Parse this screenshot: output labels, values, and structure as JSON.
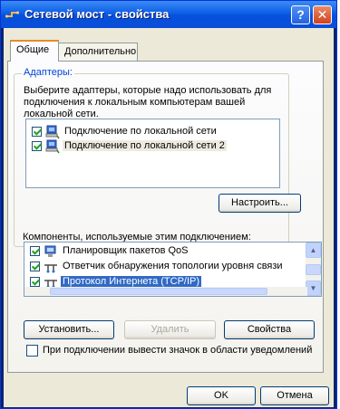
{
  "window": {
    "title": "Сетевой мост - свойства",
    "help_button": "?",
    "close_button": "✕"
  },
  "tabs": [
    {
      "label": "Общие",
      "active": true
    },
    {
      "label": "Дополнительно",
      "active": false
    }
  ],
  "adapters": {
    "legend": "Адаптеры:",
    "description": "Выберите адаптеры, которые надо использовать для подключения к локальным компьютерам вашей локальной сети.",
    "items": [
      {
        "label": "Подключение по локальной сети",
        "checked": true
      },
      {
        "label": "Подключение по локальной сети 2",
        "checked": true
      }
    ],
    "configure_button": "Настроить..."
  },
  "components": {
    "label": "Компоненты, используемые этим подключением:",
    "items": [
      {
        "label": "Планировщик пакетов QoS",
        "checked": true,
        "icon": "network-service-icon"
      },
      {
        "label": "Ответчик обнаружения топологии уровня связи",
        "checked": true,
        "icon": "protocol-icon"
      },
      {
        "label": "Протокол Интернета (TCP/IP)",
        "checked": true,
        "icon": "protocol-icon",
        "selected": true
      }
    ]
  },
  "buttons": {
    "install": "Установить...",
    "remove": "Удалить",
    "properties": "Свойства",
    "ok": "OK",
    "cancel": "Отмена"
  },
  "tray_option": {
    "label": "При подключении вывести значок в области уведомлений",
    "checked": false
  },
  "colors": {
    "title_bar": "#0a4ed8",
    "dialog_face": "#ece9d8",
    "selection": "#316ac5",
    "group_legend": "#0046d5"
  }
}
